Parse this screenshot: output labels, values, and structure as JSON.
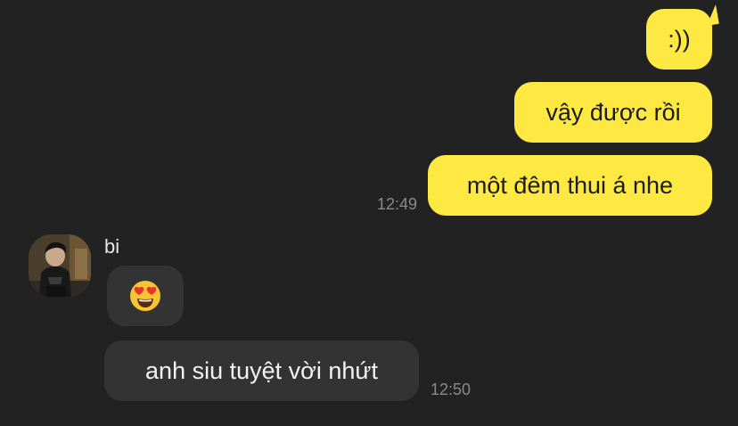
{
  "colors": {
    "background": "#222222",
    "outgoing_bubble": "#fee942",
    "incoming_bubble": "#333333",
    "timestamp": "#8a8a8a"
  },
  "outgoing_messages": [
    {
      "text": ":))"
    },
    {
      "text": "vậy được rồi"
    },
    {
      "text": "một đêm thui á nhe",
      "time": "12:49"
    }
  ],
  "incoming": {
    "sender_name": "bi",
    "avatar_icon": "profile-photo",
    "messages": [
      {
        "emoji_icon": "heart-eyes-emoji"
      },
      {
        "text": "anh siu tuyệt vời nhứt",
        "time": "12:50"
      }
    ]
  }
}
